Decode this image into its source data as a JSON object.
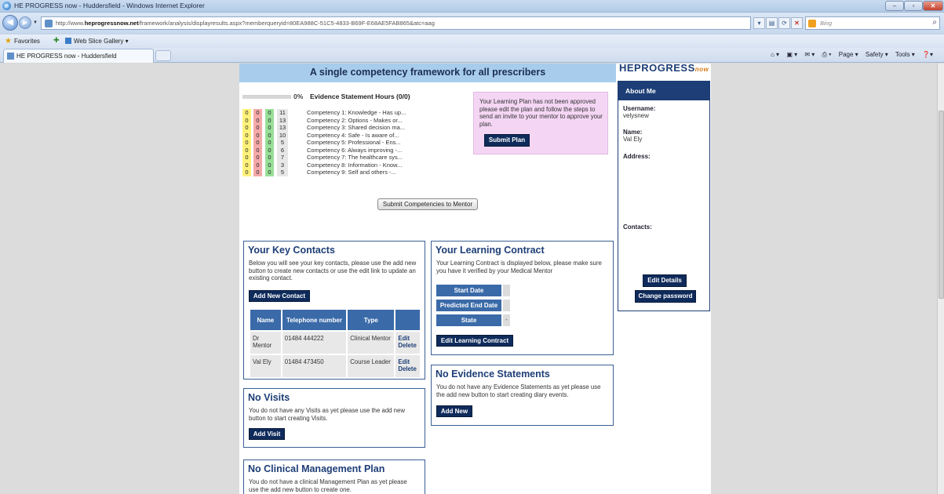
{
  "browser": {
    "window_title": "HE PROGRESS now - Huddersfield - Windows Internet Explorer",
    "url_prefix": "http://www.",
    "url_host": "heprogressnow.net",
    "url_path": "/framework/analysis/displayresults.aspx?memberqueryid=80EA988C-51C5-4833-B69F-E68AE5FAB865&atc=aag",
    "search_placeholder": "Bing",
    "favorites_label": "Favorites",
    "web_slice_label": "Web Slice Gallery ▾",
    "tab_label": "HE PROGRESS now - Huddersfield",
    "cmd_page": "Page ▾",
    "cmd_safety": "Safety ▾",
    "cmd_tools": "Tools ▾"
  },
  "banner": {
    "title": "A single competency framework for all prescribers"
  },
  "logo": {
    "main": "HEPROGRESS",
    "suffix": "now"
  },
  "about": {
    "heading": "About Me",
    "username_label": "Username:",
    "username_value": "velysnew",
    "name_label": "Name:",
    "name_value": "Val Ely",
    "address_label": "Address:",
    "contacts_label": "Contacts:",
    "edit_details": "Edit Details",
    "change_password": "Change password"
  },
  "progress": {
    "percent_label": "0%",
    "percent_value": 0,
    "title": "Evidence Statement Hours (0/0)"
  },
  "competencies": [
    {
      "y": "0",
      "r": "0",
      "g": "0",
      "t": "11",
      "name": "Competency 1: Knowledge - Has up..."
    },
    {
      "y": "0",
      "r": "0",
      "g": "0",
      "t": "13",
      "name": "Competency 2: Options - Makes or..."
    },
    {
      "y": "0",
      "r": "0",
      "g": "0",
      "t": "13",
      "name": "Competency 3: Shared decision ma..."
    },
    {
      "y": "0",
      "r": "0",
      "g": "0",
      "t": "10",
      "name": "Competency 4: Safe - Is aware of..."
    },
    {
      "y": "0",
      "r": "0",
      "g": "0",
      "t": "5",
      "name": "Competency 5: Professional - Ens..."
    },
    {
      "y": "0",
      "r": "0",
      "g": "0",
      "t": "6",
      "name": "Competency 6: Always improving -..."
    },
    {
      "y": "0",
      "r": "0",
      "g": "0",
      "t": "7",
      "name": "Competency 7: The healthcare sys..."
    },
    {
      "y": "0",
      "r": "0",
      "g": "0",
      "t": "3",
      "name": "Competency 8: Information - Know..."
    },
    {
      "y": "0",
      "r": "0",
      "g": "0",
      "t": "5",
      "name": "Competency 9: Self and others -..."
    }
  ],
  "plan_notice": {
    "text": "Your Learning Plan has not been approved please edit the plan and follow the steps to send an invite to your mentor to approve your plan.",
    "submit_label": "Submit Plan"
  },
  "submit_competencies_label": "Submit Competencies to Mentor",
  "key_contacts": {
    "heading": "Your Key Contacts",
    "intro": "Below you will see your key contacts, please use the add new button to create new contacts or use the edit link to update an existing contact.",
    "add_label": "Add New Contact",
    "columns": [
      "Name",
      "Telephone number",
      "Type",
      ""
    ],
    "rows": [
      {
        "name": "Dr Mentor",
        "phone": "01484 444222",
        "type": "Clinical Mentor",
        "edit": "Edit",
        "delete": "Delete"
      },
      {
        "name": "Val Ely",
        "phone": "01484 473450",
        "type": "Course Leader",
        "edit": "Edit",
        "delete": "Delete"
      }
    ]
  },
  "learning_contract": {
    "heading": "Your Learning Contract",
    "intro": "Your Learning Contract is displayed below, please make sure you have it verified by your Medical Mentor",
    "start_label": "Start Date",
    "start_value": "",
    "end_label": "Predicted End Date",
    "end_value": "",
    "state_label": "State",
    "state_value": "-",
    "edit_label": "Edit Learning Contract"
  },
  "evidence": {
    "heading": "No Evidence Statements",
    "intro": "You do not have any Evidence Statements as yet please use the add new button to start creating diary events.",
    "add_label": "Add New"
  },
  "visits": {
    "heading": "No Visits",
    "intro": "You do not have any Visits as yet please use the add new button to start creating Visits.",
    "add_label": "Add Visit"
  },
  "clinical_plan": {
    "heading": "No Clinical Management Plan",
    "intro": "You do not have a clinical Management Plan as yet please use the add new button to create one."
  }
}
